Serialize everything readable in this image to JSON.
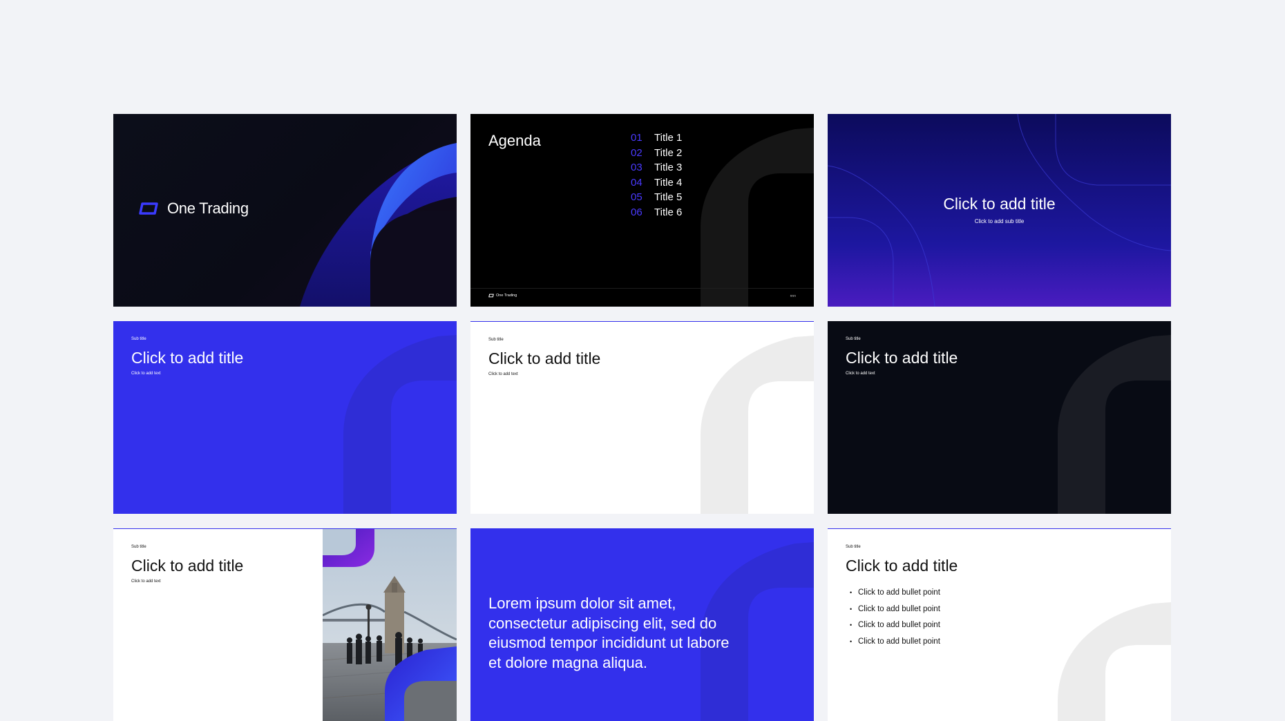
{
  "colors": {
    "page_background": "#f2f3f7",
    "brand_blue": "#3330ec",
    "agenda_number": "#4a3aff",
    "dark_navy": "#080b14",
    "indigo_gradient_top": "#0c0b5c",
    "violet_gradient_bottom": "#4a1cc0"
  },
  "slides": {
    "cover": {
      "logo_text": "One Trading",
      "logo_icon": "one-trading-logo-icon"
    },
    "agenda": {
      "title": "Agenda",
      "items": [
        {
          "number": "01",
          "label": "Title 1"
        },
        {
          "number": "02",
          "label": "Title 2"
        },
        {
          "number": "03",
          "label": "Title 3"
        },
        {
          "number": "04",
          "label": "Title 4"
        },
        {
          "number": "05",
          "label": "Title 5"
        },
        {
          "number": "06",
          "label": "Title 6"
        }
      ],
      "footer_logo": "One Trading",
      "footer_page": "nnn"
    },
    "section": {
      "title": "Click to add title",
      "subtitle": "Click to add sub title"
    },
    "title_blue": {
      "subtitle": "Sub title",
      "title": "Click to add title",
      "text": "Click to add text"
    },
    "title_white": {
      "subtitle": "Sub title",
      "title": "Click to add title",
      "text": "Click to add text"
    },
    "title_dark": {
      "subtitle": "Sub title",
      "title": "Click to add title",
      "text": "Click to add text"
    },
    "title_image": {
      "subtitle": "Sub title",
      "title": "Click to add title",
      "text": "Click to add text",
      "image": "tower-bridge-photo"
    },
    "quote": {
      "text": "Lorem ipsum dolor sit amet, consectetur adipiscing elit, sed do eiusmod tempor incididunt ut labore et dolore magna aliqua."
    },
    "bullets": {
      "subtitle": "Sub title",
      "title": "Click to add title",
      "points": [
        "Click to add bullet point",
        "Click to add bullet point",
        "Click to add bullet point",
        "Click to add bullet point"
      ]
    }
  }
}
